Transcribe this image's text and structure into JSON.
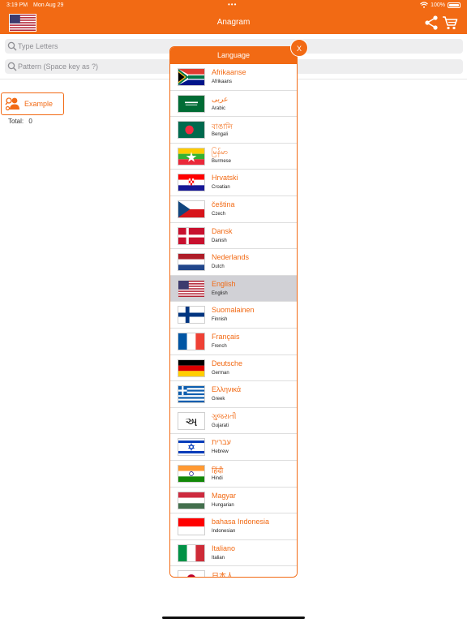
{
  "status": {
    "time": "3:19 PM",
    "date": "Mon Aug 29",
    "dots": "•••",
    "battery": "100%"
  },
  "header": {
    "title": "Anagram",
    "flag": "us-flag",
    "share_icon": "share-icon",
    "cart_icon": "cart-icon"
  },
  "search": {
    "letters_placeholder": "Type Letters",
    "pattern_placeholder": "Pattern (Space key as ?)"
  },
  "example": {
    "label": "Example"
  },
  "total": {
    "label": "Total:",
    "value": "0"
  },
  "popup": {
    "title": "Language",
    "close_label": "X",
    "languages": [
      {
        "native": "Afrikaanse",
        "english": "Afrikaans",
        "flag": "za",
        "selected": false
      },
      {
        "native": "عربى",
        "english": "Arabic",
        "flag": "sa",
        "selected": false
      },
      {
        "native": "বাঙালি",
        "english": "Bengali",
        "flag": "bd",
        "selected": false
      },
      {
        "native": "မြန်မာ",
        "english": "Burmese",
        "flag": "mm",
        "selected": false
      },
      {
        "native": "Hrvatski",
        "english": "Croatian",
        "flag": "hr",
        "selected": false
      },
      {
        "native": "čeština",
        "english": "Czech",
        "flag": "cz",
        "selected": false
      },
      {
        "native": "Dansk",
        "english": "Danish",
        "flag": "dk",
        "selected": false
      },
      {
        "native": "Nederlands",
        "english": "Dutch",
        "flag": "nl",
        "selected": false
      },
      {
        "native": "English",
        "english": "English",
        "flag": "us",
        "selected": true
      },
      {
        "native": "Suomalainen",
        "english": "Finnish",
        "flag": "fi",
        "selected": false
      },
      {
        "native": "Français",
        "english": "French",
        "flag": "fr",
        "selected": false
      },
      {
        "native": "Deutsche",
        "english": "German",
        "flag": "de",
        "selected": false
      },
      {
        "native": "Ελληνικά",
        "english": "Greek",
        "flag": "gr",
        "selected": false
      },
      {
        "native": "ગુજરાતી",
        "english": "Gujarati",
        "flag": "gu",
        "selected": false
      },
      {
        "native": "עברית",
        "english": "Hebrew",
        "flag": "il",
        "selected": false
      },
      {
        "native": "हिंदी",
        "english": "Hindi",
        "flag": "in",
        "selected": false
      },
      {
        "native": "Magyar",
        "english": "Hungarian",
        "flag": "hu",
        "selected": false
      },
      {
        "native": "bahasa Indonesia",
        "english": "Indonesian",
        "flag": "id",
        "selected": false
      },
      {
        "native": "Italiano",
        "english": "Italian",
        "flag": "it",
        "selected": false
      },
      {
        "native": "日本人",
        "english": "",
        "flag": "jp",
        "selected": false
      }
    ]
  },
  "colors": {
    "accent": "#f26a14",
    "selected_row": "#d1d1d6",
    "search_bg": "#eeeeef"
  }
}
